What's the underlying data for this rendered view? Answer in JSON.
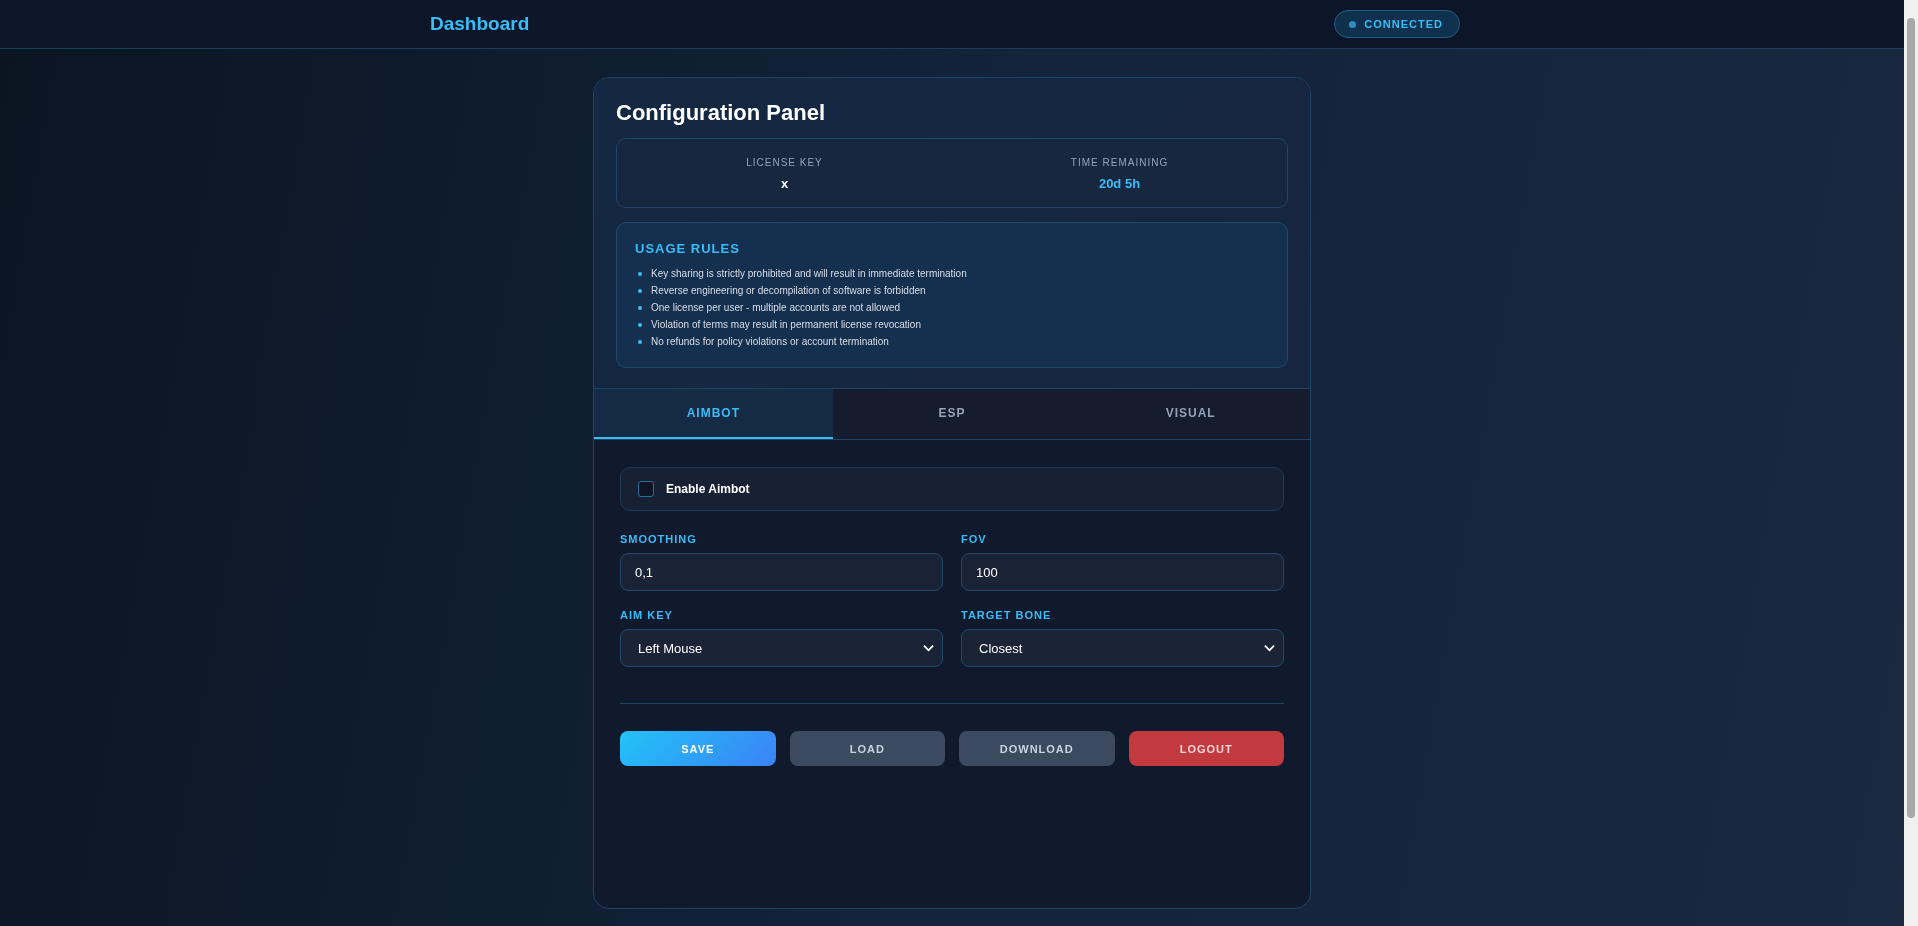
{
  "header": {
    "title": "Dashboard",
    "status": {
      "label": "CONNECTED",
      "connected": true
    }
  },
  "panel": {
    "title": "Configuration Panel",
    "info": [
      {
        "label": "LICENSE KEY",
        "value": "x",
        "kind": "plain"
      },
      {
        "label": "TIME REMAINING",
        "value": "20d 5h",
        "kind": "accent"
      }
    ],
    "rules": {
      "title": "USAGE RULES",
      "items": [
        "Key sharing is strictly prohibited and will result in immediate termination",
        "Reverse engineering or decompilation of software is forbidden",
        "One license per user - multiple accounts are not allowed",
        "Violation of terms may result in permanent license revocation",
        "No refunds for policy violations or account termination"
      ]
    },
    "tabs": [
      {
        "label": "AIMBOT",
        "selected": true
      },
      {
        "label": "ESP",
        "selected": false
      },
      {
        "label": "VISUAL",
        "selected": false
      }
    ],
    "toggle": {
      "label": "Enable Aimbot",
      "checked": false
    },
    "fields": [
      {
        "label": "SMOOTHING",
        "value": "0,1",
        "kind": "input"
      },
      {
        "label": "FOV",
        "value": "100",
        "kind": "input"
      },
      {
        "label": "AIM KEY",
        "value": "Left Mouse",
        "kind": "select"
      },
      {
        "label": "TARGET BONE",
        "value": "Closest",
        "kind": "select"
      }
    ],
    "buttons": [
      {
        "label": "SAVE",
        "kind": "primary"
      },
      {
        "label": "LOAD",
        "kind": "secondary"
      },
      {
        "label": "DOWNLOAD",
        "kind": "secondary"
      },
      {
        "label": "LOGOUT",
        "kind": "danger"
      }
    ]
  }
}
